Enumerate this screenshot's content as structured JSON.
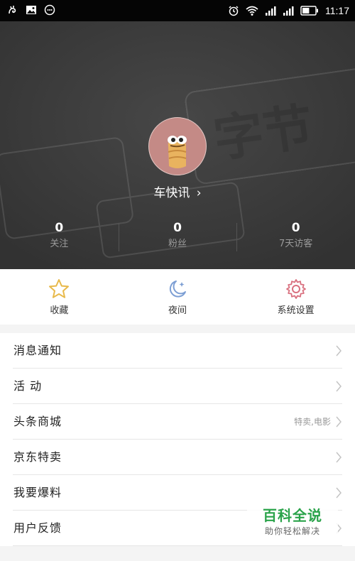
{
  "status_bar": {
    "time": "11:17",
    "battery_level": 0.55,
    "left_icons": [
      "squirrel-icon",
      "image-icon",
      "chat-icon"
    ],
    "right_icons": [
      "alarm-icon",
      "wifi-icon",
      "signal-icon",
      "signal-icon",
      "battery-icon"
    ]
  },
  "profile": {
    "username": "车快讯",
    "chevron": "›",
    "stats": [
      {
        "value": "0",
        "label": "关注"
      },
      {
        "value": "0",
        "label": "粉丝"
      },
      {
        "value": "0",
        "label": "7天访客"
      }
    ]
  },
  "quick_actions": [
    {
      "label": "收藏",
      "icon": "star-icon",
      "color": "#e8b94a"
    },
    {
      "label": "夜间",
      "icon": "moon-icon",
      "color": "#7d9fd4"
    },
    {
      "label": "系统设置",
      "icon": "gear-icon",
      "color": "#d9707f"
    }
  ],
  "menu": [
    {
      "label": "消息通知",
      "sub": ""
    },
    {
      "label": "活 动",
      "sub": ""
    },
    {
      "label": "头条商城",
      "sub": "特卖,电影"
    },
    {
      "label": "京东特卖",
      "sub": ""
    },
    {
      "label": "我要爆料",
      "sub": ""
    },
    {
      "label": "用户反馈",
      "sub": ""
    }
  ],
  "watermark": {
    "title": "百科全说",
    "subtitle": "助你轻松解决"
  },
  "colors": {
    "header_bg": "#3d3d3d",
    "status_bar_bg": "#050505",
    "watermark_green": "#2aa34a"
  }
}
